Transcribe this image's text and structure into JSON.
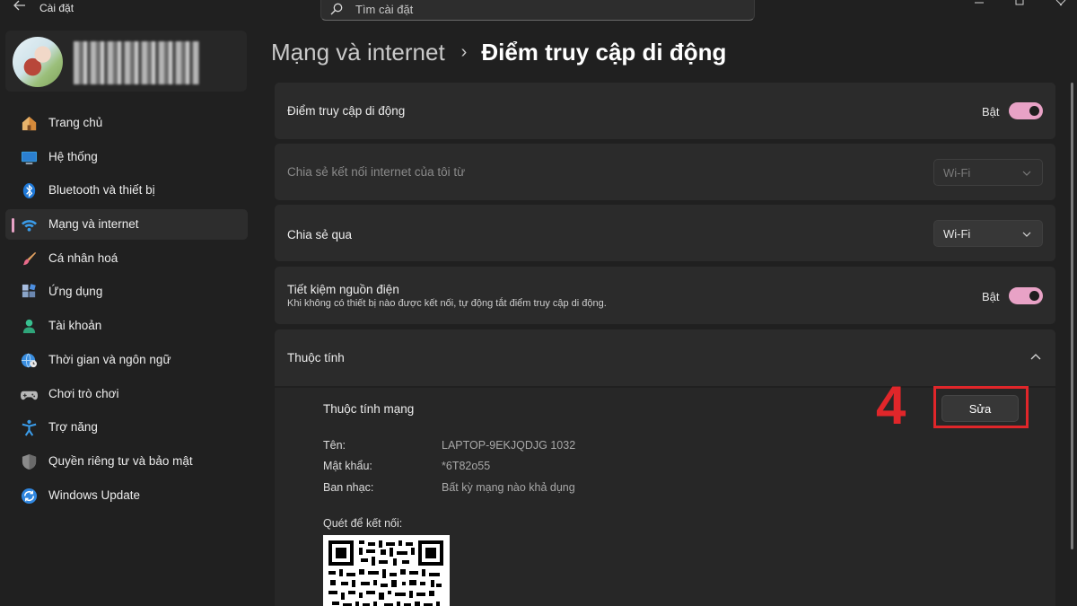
{
  "window": {
    "title": "Cài đặt"
  },
  "search": {
    "placeholder": "Tìm cài đặt"
  },
  "sidebar": {
    "items": [
      {
        "label": "Trang chủ",
        "icon": "home-icon"
      },
      {
        "label": "Hệ thống",
        "icon": "system-icon"
      },
      {
        "label": "Bluetooth và thiết bị",
        "icon": "bluetooth-icon"
      },
      {
        "label": "Mạng và internet",
        "icon": "wifi-icon",
        "active": true
      },
      {
        "label": "Cá nhân hoá",
        "icon": "brush-icon"
      },
      {
        "label": "Ứng dụng",
        "icon": "apps-icon"
      },
      {
        "label": "Tài khoản",
        "icon": "account-icon"
      },
      {
        "label": "Thời gian và ngôn ngữ",
        "icon": "globe-clock-icon"
      },
      {
        "label": "Chơi trò chơi",
        "icon": "gamepad-icon"
      },
      {
        "label": "Trợ năng",
        "icon": "accessibility-icon"
      },
      {
        "label": "Quyền riêng tư và bảo mật",
        "icon": "shield-icon"
      },
      {
        "label": "Windows Update",
        "icon": "update-icon"
      }
    ]
  },
  "breadcrumb": {
    "parent": "Mạng và internet",
    "separator": "›",
    "current": "Điểm truy cập di động"
  },
  "hotspot": {
    "label": "Điểm truy cập di động",
    "toggle_text": "Bật",
    "on": true
  },
  "share_from": {
    "label": "Chia sẻ kết nối internet của tôi từ",
    "value": "Wi-Fi",
    "disabled": true
  },
  "share_over": {
    "label": "Chia sẻ qua",
    "value": "Wi-Fi"
  },
  "power_saving": {
    "label": "Tiết kiệm nguồn điện",
    "description": "Khi không có thiết bị nào được kết nối, tự động tắt điểm truy cập di động.",
    "toggle_text": "Bật",
    "on": true
  },
  "properties": {
    "section_label": "Thuộc tính",
    "network_props_label": "Thuộc tính mạng",
    "edit_label": "Sửa",
    "fields": [
      {
        "key": "Tên:",
        "value": "LAPTOP-9EKJQDJG 1032"
      },
      {
        "key": "Mật khẩu:",
        "value": "*6T82o55"
      },
      {
        "key": "Ban nhạc:",
        "value": "Bất kỳ mạng nào khả dụng"
      }
    ],
    "qr_label": "Quét để kết nối:"
  },
  "annotation": {
    "step_number": "4",
    "color": "#e0262a"
  },
  "colors": {
    "accent": "#e8a2c6",
    "background": "#202020",
    "card": "#2b2b2b"
  }
}
